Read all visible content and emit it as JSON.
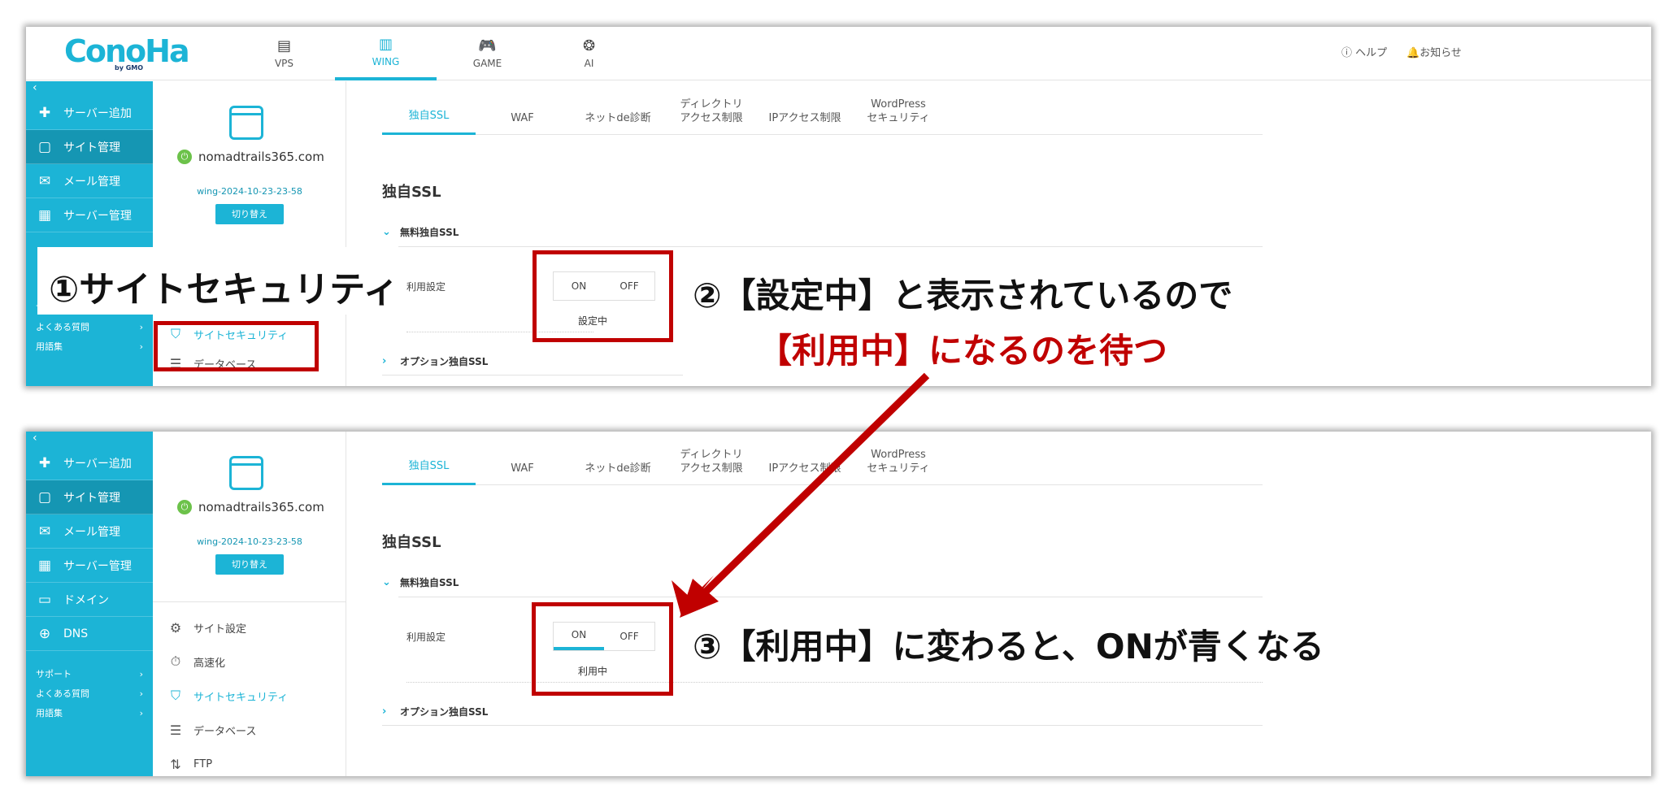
{
  "header": {
    "logo": "ConoHa",
    "logo_sub": "by GMO",
    "nav": [
      {
        "label": "VPS",
        "icon": "server-icon",
        "glyph": "▤"
      },
      {
        "label": "WING",
        "icon": "wing-icon",
        "glyph": "▥"
      },
      {
        "label": "GAME",
        "icon": "gamepad-icon",
        "glyph": "🎮"
      },
      {
        "label": "AI",
        "icon": "ai-brain-icon",
        "glyph": "❂"
      }
    ],
    "help": "ヘルプ",
    "news": "お知らせ"
  },
  "sidebar": {
    "collapse": "‹",
    "items": [
      {
        "label": "サーバー追加",
        "icon": "plus-icon",
        "glyph": "✚"
      },
      {
        "label": "サイト管理",
        "icon": "site-window-icon",
        "glyph": "▢"
      },
      {
        "label": "メール管理",
        "icon": "mail-icon",
        "glyph": "✉"
      },
      {
        "label": "サーバー管理",
        "icon": "server-manage-icon",
        "glyph": "▦"
      },
      {
        "label": "ドメイン",
        "icon": "domain-icon",
        "glyph": "▭"
      },
      {
        "label": "DNS",
        "icon": "globe-icon",
        "glyph": "⊕"
      }
    ],
    "links": [
      {
        "label": "サポート",
        "arrow": "›"
      },
      {
        "label": "よくある質問",
        "arrow": "›"
      },
      {
        "label": "用語集",
        "arrow": "›"
      }
    ]
  },
  "site": {
    "domain": "nomadtrails365.com",
    "wing_id": "wing-2024-10-23-23-58",
    "switch_label": "切り替え",
    "menu": [
      {
        "label": "サイト設定",
        "icon": "site-settings-icon",
        "glyph": "⚙"
      },
      {
        "label": "高速化",
        "icon": "stopwatch-icon",
        "glyph": "⏱"
      },
      {
        "label": "サイトセキュリティ",
        "icon": "shield-check-icon",
        "glyph": "⛉"
      },
      {
        "label": "データベース",
        "icon": "database-icon",
        "glyph": "☰"
      },
      {
        "label": "FTP",
        "icon": "ftp-arrows-icon",
        "glyph": "⇅"
      }
    ]
  },
  "main": {
    "tabs": [
      "独自SSL",
      "WAF",
      "ネットde診断",
      "ディレクトリ\nアクセス制限",
      "IPアクセス制限",
      "WordPress\nセキュリティ"
    ],
    "section_title": "独自SSL",
    "free_ssl": "無料独自SSL",
    "setting_label": "利用設定",
    "on_label": "ON",
    "off_label": "OFF",
    "status_before": "設定中",
    "status_after": "利用中",
    "option_ssl": "オプション独自SSL"
  },
  "annotations": {
    "step1": "①サイトセキュリティ",
    "step2": "②【設定中】と表示されているので",
    "step2_red": "【利用中】になるのを待つ",
    "step3": "③【利用中】に変わると、ONが青くなる"
  },
  "colors": {
    "brand": "#1cb4d6",
    "annotation_red": "#c00000",
    "power_green": "#6cc24a"
  }
}
